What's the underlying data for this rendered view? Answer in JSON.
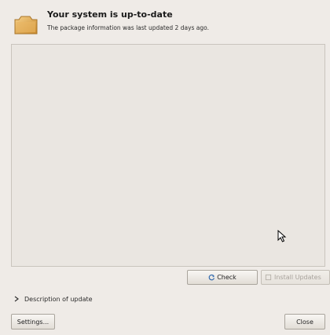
{
  "header": {
    "icon": "package-icon",
    "title": "Your system is up-to-date",
    "subtitle": "The package information was last updated 2 days ago."
  },
  "updates_list": {
    "items": []
  },
  "actions": {
    "check_label": "Check",
    "check_icon": "refresh-icon",
    "install_label": "Install Updates",
    "install_icon": "install-icon",
    "install_enabled": false
  },
  "details": {
    "expander_label": "Description of update",
    "expanded": false
  },
  "footer": {
    "settings_label": "Settings...",
    "close_label": "Close"
  },
  "colors": {
    "window_bg": "#efebe7",
    "list_bg": "#eae6e1",
    "icon_accent": "#e0a64a"
  }
}
